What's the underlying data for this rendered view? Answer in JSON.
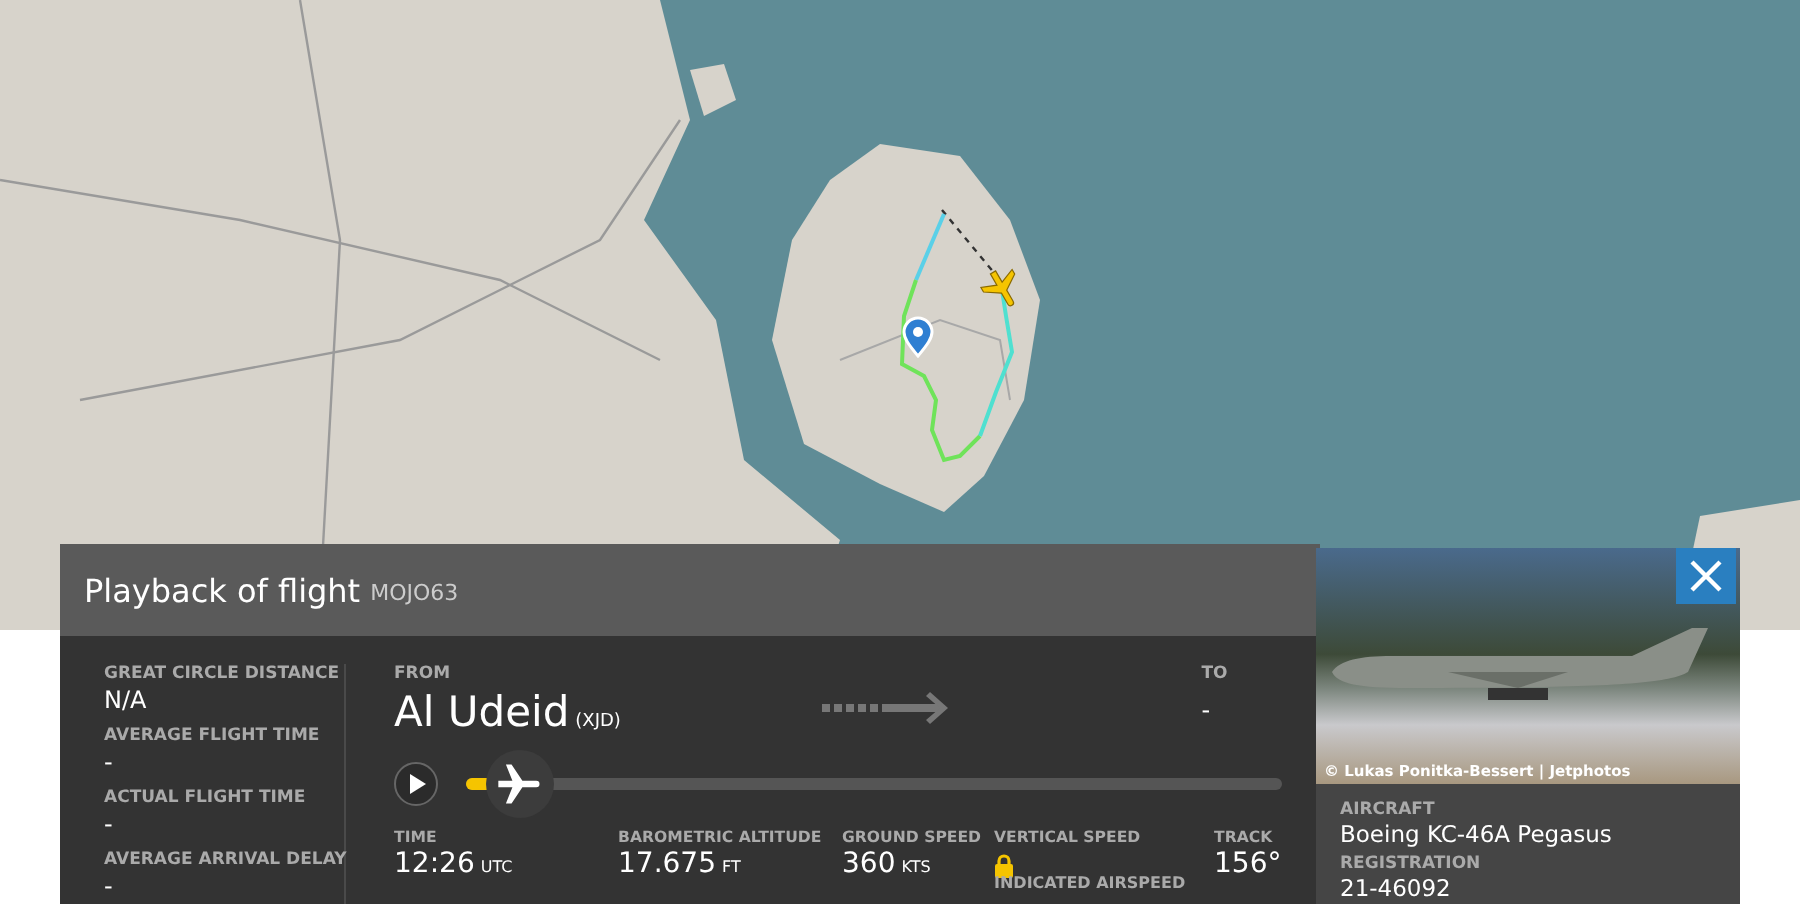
{
  "header": {
    "title": "Playback of flight",
    "callsign": "MOJO63"
  },
  "stats": [
    {
      "label": "GREAT CIRCLE DISTANCE",
      "value": "N/A"
    },
    {
      "label": "AVERAGE FLIGHT TIME",
      "value": "-"
    },
    {
      "label": "ACTUAL FLIGHT TIME",
      "value": "-"
    },
    {
      "label": "AVERAGE ARRIVAL DELAY",
      "value": "-"
    }
  ],
  "route": {
    "from_label": "FROM",
    "from_name": "Al Udeid",
    "from_code": "(XJD)",
    "to_label": "TO",
    "to_value": "-"
  },
  "playback": {
    "playing": false,
    "level": 0.04
  },
  "telemetry": [
    {
      "kind": "value",
      "label": "TIME",
      "value": "12:26",
      "unit": "UTC"
    },
    {
      "kind": "value",
      "label": "BAROMETRIC ALTITUDE",
      "value": "17.675",
      "unit": "FT"
    },
    {
      "kind": "value",
      "label": "GROUND SPEED",
      "value": "360",
      "unit": "KTS"
    },
    {
      "kind": "locked",
      "label": "VERTICAL SPEED",
      "sublabel": "INDICATED AIRSPEED"
    },
    {
      "kind": "value",
      "label": "TRACK",
      "value": "156°"
    }
  ],
  "aircraft": {
    "photo_credit": "© Lukas Ponitka-Bessert | Jetphotos",
    "fields": [
      {
        "label": "AIRCRAFT",
        "value": "Boeing KC-46A Pegasus"
      },
      {
        "label": "REGISTRATION",
        "value": "21-46092"
      }
    ]
  }
}
